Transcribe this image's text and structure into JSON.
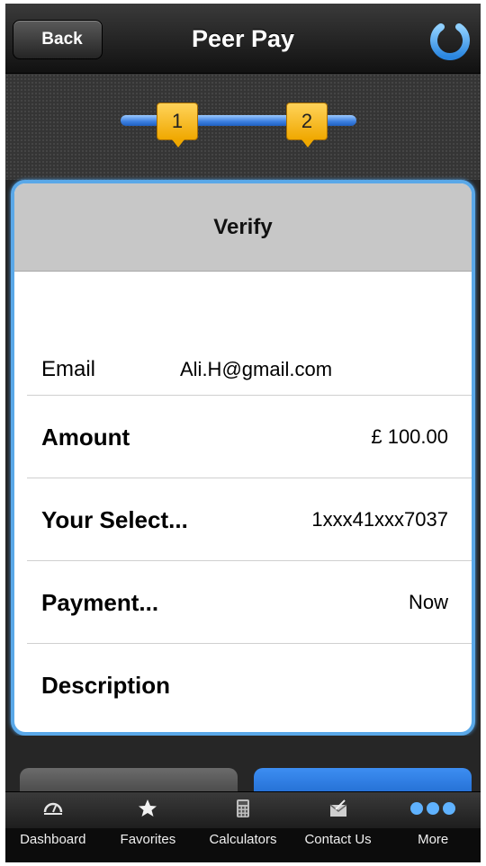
{
  "nav": {
    "back_label": "Back",
    "title": "Peer Pay",
    "power_icon": "power-icon"
  },
  "stepper": {
    "steps": [
      "1",
      "2"
    ],
    "accent": "#3b7fe0",
    "badge_color": "#f0a800"
  },
  "card": {
    "header": "Verify",
    "rows": [
      {
        "label": "Email",
        "value": "Ali.H@gmail.com"
      },
      {
        "label": "Amount",
        "value": "£ 100.00"
      },
      {
        "label": "Your Select...",
        "value": "1xxx41xxx7037"
      },
      {
        "label": "Payment...",
        "value": "Now"
      },
      {
        "label": "Description",
        "value": ""
      }
    ],
    "border_color": "#5aa8e8"
  },
  "tabbar": {
    "tabs": [
      {
        "label": "Dashboard",
        "icon": "gauge-icon"
      },
      {
        "label": "Favorites",
        "icon": "star-icon"
      },
      {
        "label": "Calculators",
        "icon": "calculator-icon"
      },
      {
        "label": "Contact Us",
        "icon": "mail-icon"
      },
      {
        "label": "More",
        "icon": "more-dots-icon"
      }
    ]
  }
}
